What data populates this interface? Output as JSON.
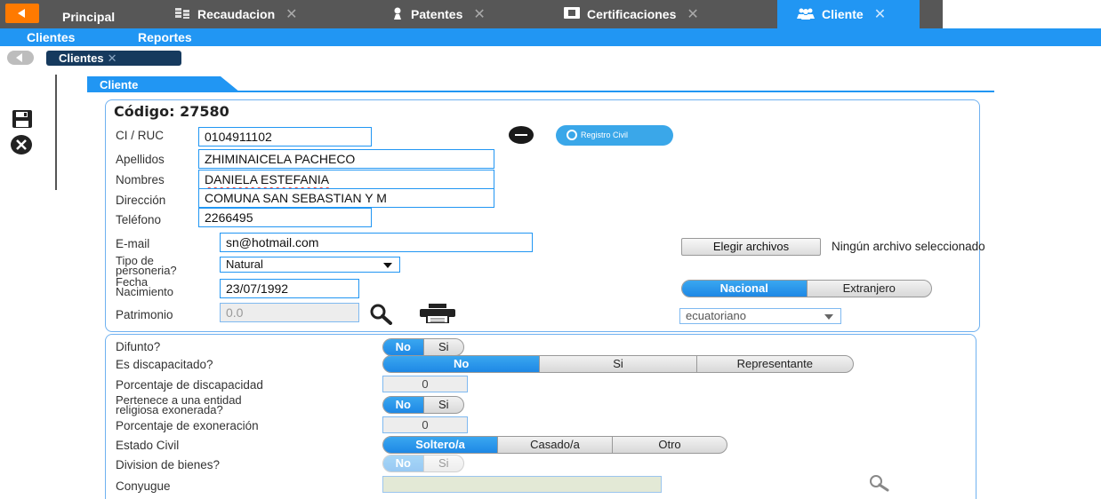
{
  "topbar": {
    "tabs": [
      {
        "label": "Principal",
        "icon": "none"
      },
      {
        "label": "Recaudacion",
        "icon": "coins-icon"
      },
      {
        "label": "Patentes",
        "icon": "person-icon"
      },
      {
        "label": "Certificaciones",
        "icon": "certificate-icon"
      },
      {
        "label": "Cliente",
        "icon": "users-icon"
      }
    ],
    "close_glyph": "✕",
    "active_tab": "Cliente"
  },
  "menubar": {
    "items": [
      "Clientes",
      "Reportes"
    ]
  },
  "breadcrumb": {
    "label": "Clientes",
    "close_glyph": "✕"
  },
  "section": {
    "tab_label": "Cliente"
  },
  "cliente": {
    "codigo_label": "Código:",
    "codigo_value": "27580",
    "ci_label": "CI / RUC",
    "ci_value": "0104911102",
    "apellidos_label": "Apellidos",
    "apellidos_value": "ZHIMINAICELA PACHECO",
    "nombres_label": "Nombres",
    "nombres_value": "DANIELA ESTEFANIA",
    "direccion_label": "Dirección",
    "direccion_value": "COMUNA SAN SEBASTIAN Y M",
    "telefono_label": "Teléfono",
    "telefono_value": "2266495",
    "email_label": "E-mail",
    "email_value": "sn@hotmail.com",
    "tipo_label_1": "Tipo de",
    "tipo_label_2": "personeria?",
    "tipo_value": "Natural",
    "fecha_label_1": "Fecha",
    "fecha_label_2": "Nacimiento",
    "fecha_value": "23/07/1992",
    "patrimonio_label": "Patrimonio",
    "patrimonio_value": "0.0",
    "registro_civil_label": "Registro Civil",
    "file_button_label": "Elegir archivos",
    "file_status": "Ningún archivo seleccionado",
    "nacionalidad_options": [
      "Nacional",
      "Extranjero"
    ],
    "nacionalidad_selected": "Nacional",
    "nacionalidad_value": "ecuatoriano"
  },
  "detalle": {
    "difunto_label": "Difunto?",
    "difunto_options": [
      "No",
      "Si"
    ],
    "discapacitado_label": "Es discapacitado?",
    "discapacitado_options": [
      "No",
      "Si",
      "Representante"
    ],
    "porc_discapacidad_label": "Porcentaje de discapacidad",
    "porc_discapacidad_value": "0",
    "religiosa_label_1": "Pertenece a una entidad",
    "religiosa_label_2": "religiosa exonerada?",
    "religiosa_options": [
      "No",
      "Si"
    ],
    "porc_exoneracion_label": "Porcentaje de exoneración",
    "porc_exoneracion_value": "0",
    "estado_civil_label": "Estado Civil",
    "estado_civil_options": [
      "Soltero/a",
      "Casado/a",
      "Otro"
    ],
    "division_label": "Division de bienes?",
    "division_options": [
      "No",
      "Si"
    ],
    "conyugue_label": "Conyugue",
    "conyugue_value": ""
  },
  "colors": {
    "accent": "#2196f3",
    "tabbar": "#575757",
    "back": "#ff7a00",
    "breadcrumb": "#163a5e"
  }
}
